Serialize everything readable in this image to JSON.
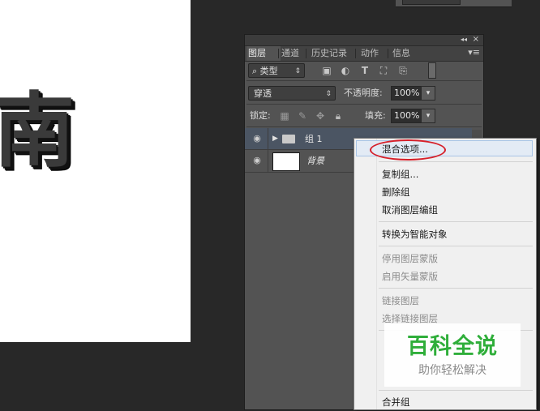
{
  "canvas": {
    "char": "南"
  },
  "panel": {
    "tabs": [
      "图层",
      "通道",
      "历史记录",
      "动作",
      "信息"
    ],
    "filter": {
      "label": "类型"
    },
    "blend_mode": "穿透",
    "opacity_label": "不透明度:",
    "opacity_value": "100%",
    "lock_label": "锁定:",
    "fill_label": "填充:",
    "fill_value": "100%",
    "layers": [
      {
        "name": "组 1",
        "type": "group",
        "selected": true
      },
      {
        "name": "背景",
        "type": "background",
        "selected": false
      }
    ]
  },
  "context_menu": {
    "items": [
      {
        "label": "混合选项...",
        "enabled": true,
        "highlighted": true
      },
      {
        "label": "复制组...",
        "enabled": true
      },
      {
        "label": "删除组",
        "enabled": true
      },
      {
        "label": "取消图层编组",
        "enabled": true
      },
      {
        "label": "转换为智能对象",
        "enabled": true
      },
      {
        "label": "停用图层蒙版",
        "enabled": false
      },
      {
        "label": "启用矢量蒙版",
        "enabled": false
      },
      {
        "label": "链接图层",
        "enabled": false
      },
      {
        "label": "选择链接图层",
        "enabled": false
      },
      {
        "label": "合并组",
        "enabled": true
      }
    ]
  },
  "watermark": {
    "title": "百科全说",
    "subtitle": "助你轻松解决"
  },
  "colors": {
    "annotation": "#d6202a",
    "watermark": "#2fae3a"
  }
}
